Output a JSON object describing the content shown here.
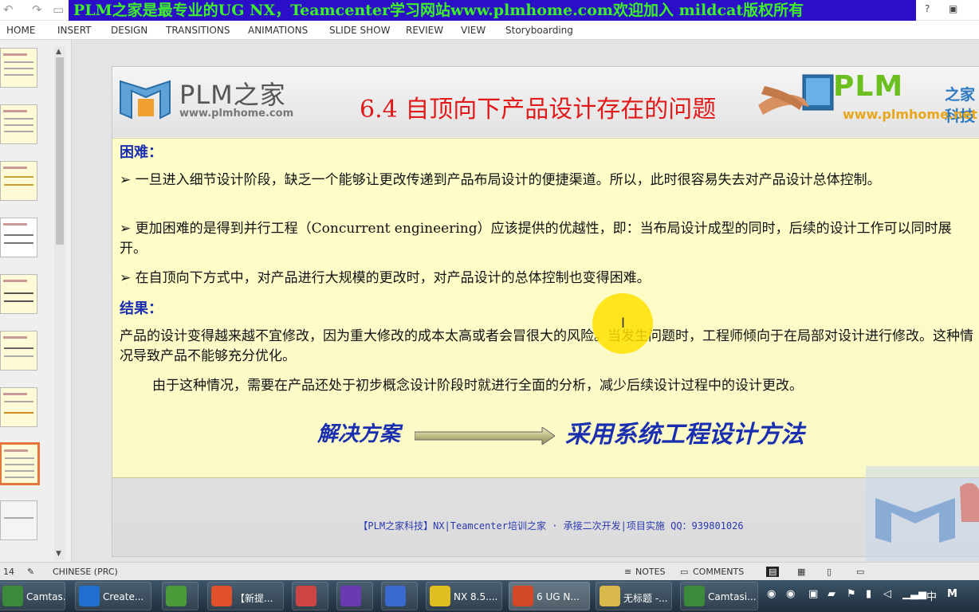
{
  "banner": "PLM之家是最专业的UG NX，Teamcenter学习网站www.plmhome.com欢迎加入 mildcat版权所有",
  "ribbon_tabs": [
    "HOME",
    "INSERT",
    "DESIGN",
    "TRANSITIONS",
    "ANIMATIONS",
    "SLIDE SHOW",
    "REVIEW",
    "VIEW",
    "Storyboarding"
  ],
  "window_controls": {
    "help": "?"
  },
  "slide": {
    "brand": "PLM之家",
    "brand_url": "www.plmhome.com",
    "title": "6.4  自顶向下产品设计存在的问题",
    "brand_right": "PLM",
    "brand_right_sub": "之家科技",
    "brand_right_url": "www.plmhome.net",
    "label_difficulty": "困难：",
    "p1": "➢  一旦进入细节设计阶段，缺乏一个能够让更改传递到产品布局设计的便捷渠道。所以，此时很容易失去对产品设计总体控制。",
    "p2": "➢ 更加困难的是得到并行工程（Concurrent  engineering）应该提供的优越性，即：当布局设计成型的同时，后续的设计工作可以同时展开。",
    "p3": "➢  在自顶向下方式中，对产品进行大规模的更改时，对产品设计的总体控制也变得困难。",
    "label_result": "结果：",
    "p4": "  产品的设计变得越来越不宜修改，因为重大修改的成本太高或者会冒很大的风险。当发生问题时，工程师倾向于在局部对设计进行修改。这种情况导致产品不能够充分优化。",
    "p5": "由于这种情况，需要在产品还处于初步概念设计阶段时就进行全面的分析，减少后续设计过程中的设计更改。",
    "solution": "解决方案",
    "method": "采用系统工程设计方法",
    "footer": "【PLM之家科技】NX|Teamcenter培训之家 · 承接二次开发|项目实施 QQ：939801026"
  },
  "status": {
    "slide_num": "14",
    "language": "CHINESE (PRC)",
    "notes": "NOTES",
    "comments": "COMMENTS"
  },
  "taskbar": [
    {
      "label": "Camtas...",
      "color": "#3a8a3a"
    },
    {
      "label": "Create...",
      "color": "#1f6fd0"
    },
    {
      "label": "",
      "color": "#4a9a3a"
    },
    {
      "label": "【新提...",
      "color": "#e0502a"
    },
    {
      "label": "",
      "color": "#cc4444"
    },
    {
      "label": "",
      "color": "#6a3bb0"
    },
    {
      "label": "",
      "color": "#3a6ad0"
    },
    {
      "label": "NX 8.5....",
      "color": "#e0c020"
    },
    {
      "label": "6 UG N...",
      "color": "#d24726"
    },
    {
      "label": "无标题 -...",
      "color": "#d8b84a"
    },
    {
      "label": "Camtasi...",
      "color": "#3a8a3a"
    }
  ],
  "tray": {
    "ime": "中",
    "letter": "M"
  }
}
